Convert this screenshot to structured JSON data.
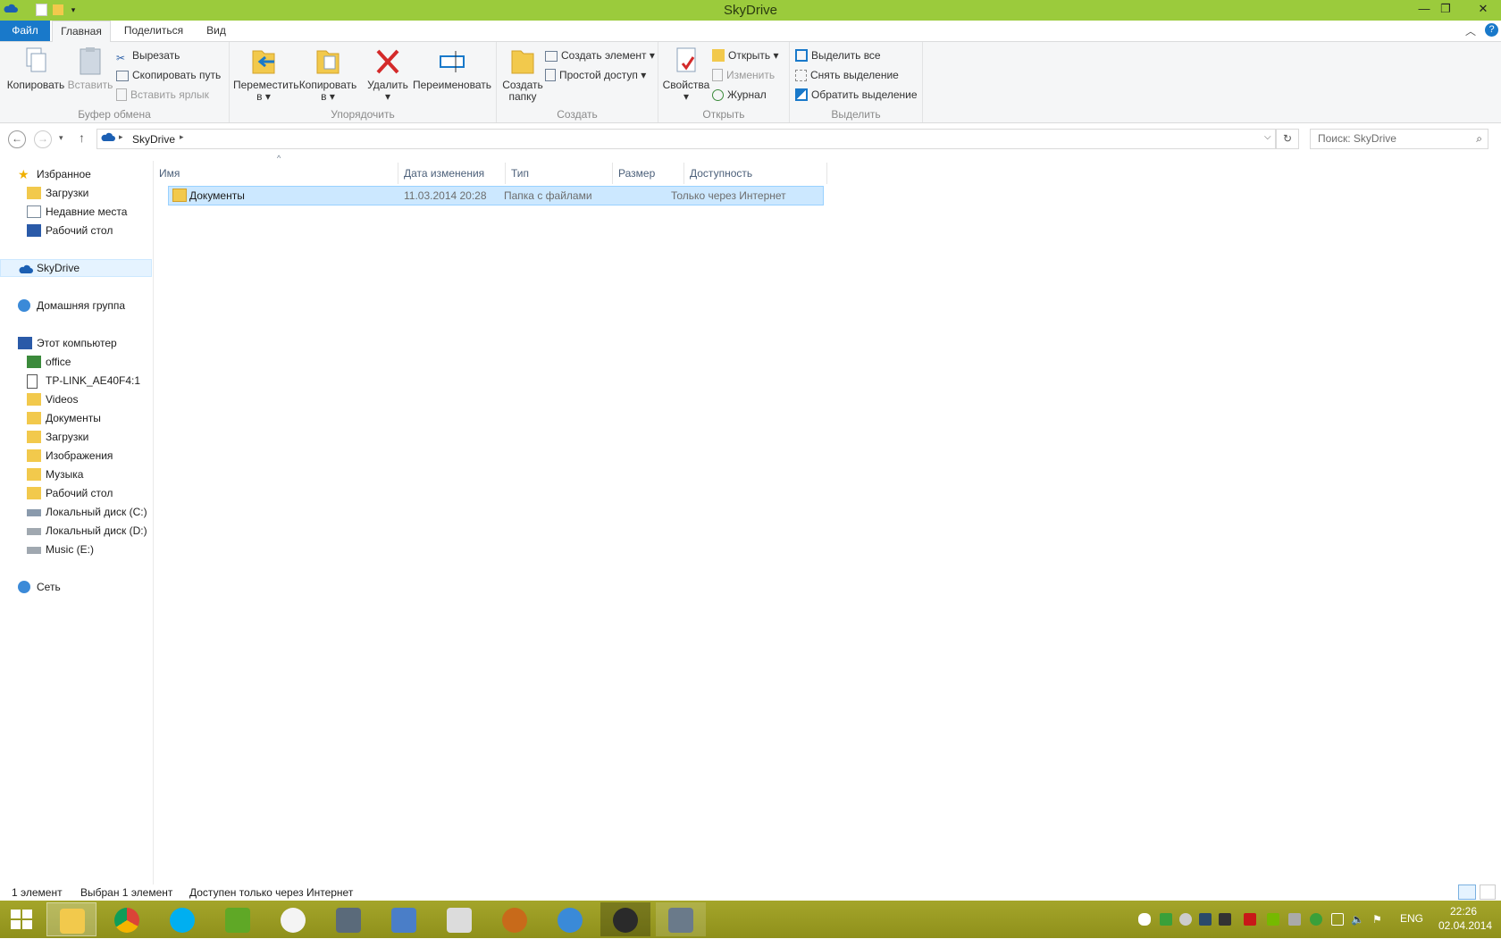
{
  "window": {
    "title": "SkyDrive"
  },
  "tabs": {
    "file": "Файл",
    "home": "Главная",
    "share": "Поделиться",
    "view": "Вид"
  },
  "ribbon": {
    "clipboard": {
      "label": "Буфер обмена",
      "copy": "Копировать",
      "paste": "Вставить",
      "cut": "Вырезать",
      "copy_path": "Скопировать путь",
      "paste_shortcut": "Вставить ярлык"
    },
    "organize": {
      "label": "Упорядочить",
      "move_to_l1": "Переместить",
      "move_to_l2": "в",
      "copy_to_l1": "Копировать",
      "copy_to_l2": "в",
      "delete": "Удалить",
      "rename": "Переименовать"
    },
    "new": {
      "label": "Создать",
      "new_folder_l1": "Создать",
      "new_folder_l2": "папку",
      "new_item": "Создать элемент",
      "easy_access": "Простой доступ"
    },
    "open": {
      "label": "Открыть",
      "properties": "Свойства",
      "open": "Открыть",
      "edit": "Изменить",
      "history": "Журнал"
    },
    "select": {
      "label": "Выделить",
      "select_all": "Выделить все",
      "select_none": "Снять выделение",
      "invert": "Обратить выделение"
    }
  },
  "address": {
    "path": "SkyDrive",
    "search_placeholder": "Поиск: SkyDrive"
  },
  "nav": {
    "favorites": "Избранное",
    "fav_items": [
      "Загрузки",
      "Недавние места",
      "Рабочий стол"
    ],
    "skydrive": "SkyDrive",
    "homegroup": "Домашняя группа",
    "computer": "Этот компьютер",
    "computer_items": [
      "office",
      "TP-LINK_AE40F4:1",
      "Videos",
      "Документы",
      "Загрузки",
      "Изображения",
      "Музыка",
      "Рабочий стол",
      "Локальный диск (C:)",
      "Локальный диск (D:)",
      "Music (E:)"
    ],
    "network": "Сеть"
  },
  "columns": {
    "name": "Имя",
    "date": "Дата изменения",
    "type": "Тип",
    "size": "Размер",
    "availability": "Доступность"
  },
  "files": [
    {
      "name": "Документы",
      "date": "11.03.2014 20:28",
      "type": "Папка с файлами",
      "size": "",
      "availability": "Только через Интернет"
    }
  ],
  "status": {
    "count": "1 элемент",
    "selected": "Выбран 1 элемент",
    "availability": "Доступен только через Интернет"
  },
  "taskbar": {
    "lang": "ENG",
    "time": "22:26",
    "date": "02.04.2014"
  },
  "colors": {
    "titlebar": "#9bcb3c",
    "file_tab": "#1979ca",
    "selection": "#cce8ff",
    "taskbar": "#9a9b1f"
  }
}
